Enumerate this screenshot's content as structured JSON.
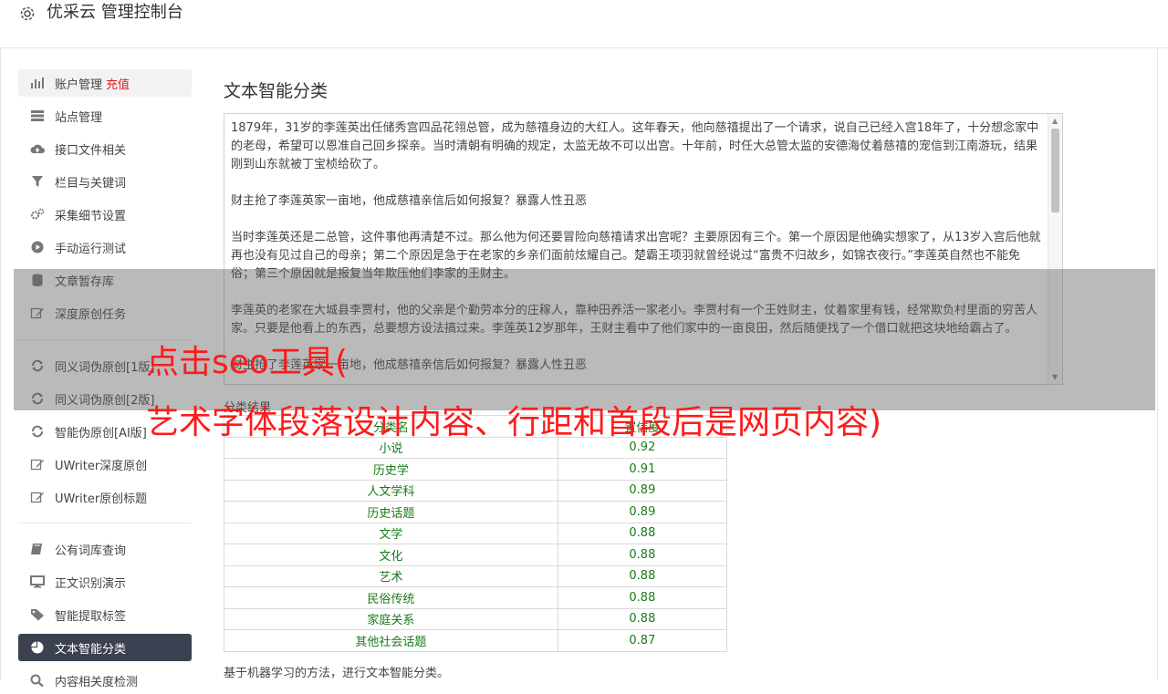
{
  "header": {
    "title": "优采云 管理控制台"
  },
  "sidebar": {
    "items": [
      {
        "label": "账户管理",
        "badge": "充值",
        "icon": "bar-chart-icon"
      },
      {
        "label": "站点管理",
        "icon": "server-icon"
      },
      {
        "label": "接口文件相关",
        "icon": "cloud-upload-icon"
      },
      {
        "label": "栏目与关键词",
        "icon": "filter-icon"
      },
      {
        "label": "采集细节设置",
        "icon": "gears-icon"
      },
      {
        "label": "手动运行测试",
        "icon": "play-circle-icon"
      },
      {
        "label": "文章暂存库",
        "icon": "database-icon"
      },
      {
        "label": "深度原创任务",
        "icon": "edit-icon"
      },
      {
        "label": "同义词伪原创[1版]",
        "icon": "refresh-icon"
      },
      {
        "label": "同义词伪原创[2版]",
        "icon": "refresh-icon"
      },
      {
        "label": "智能伪原创[AI版]",
        "icon": "refresh-icon"
      },
      {
        "label": "UWriter深度原创",
        "icon": "edit-icon"
      },
      {
        "label": "UWriter原创标题",
        "icon": "edit-icon"
      },
      {
        "label": "公有词库查询",
        "icon": "book-icon"
      },
      {
        "label": "正文识别演示",
        "icon": "monitor-icon"
      },
      {
        "label": "智能提取标签",
        "icon": "tag-icon"
      },
      {
        "label": "文本智能分类",
        "icon": "pie-chart-icon"
      },
      {
        "label": "内容相关度检测",
        "icon": "search-icon"
      }
    ]
  },
  "main": {
    "title": "文本智能分类",
    "paragraphs": [
      "1879年，31岁的李莲英出任储秀宫四品花翎总管，成为慈禧身边的大红人。这年春天，他向慈禧提出了一个请求，说自己已经入宫18年了，十分想念家中的老母，希望可以恩准自己回乡探亲。当时清朝有明确的规定，太监无故不可以出宫。十年前，时任大总管太监的安德海仗着慈禧的宠信到江南游玩，结果刚到山东就被丁宝桢给砍了。",
      "财主抢了李莲英家一亩地，他成慈禧亲信后如何报复？暴露人性丑恶",
      "当时李莲英还是二总管，这件事他再清楚不过。那么他为何还要冒险向慈禧请求出宫呢？主要原因有三个。第一个原因是他确实想家了，从13岁入宫后他就再也没有见过自己的母亲；第二个原因是急于在老家的乡亲们面前炫耀自己。楚霸王项羽就曾经说过“富贵不归故乡，如锦衣夜行。”李莲英自然也不能免俗；第三个原因就是报复当年欺压他们李家的王财主。",
      "李莲英的老家在大城县李贾村，他的父亲是个勤劳本分的庄稼人，靠种田养活一家老小。李贾村有一个王姓财主，仗着家里有钱，经常欺负村里面的穷苦人家。只要是他看上的东西，总要想方设法搞过来。李莲英12岁那年，王财主看中了他们家中的一亩良田，然后随便找了一个借口就把这块地给霸占了。",
      "财主抢了李莲英家一亩地，他成慈禧亲信后如何报复？暴露人性丑恶"
    ],
    "result_label": "分类结果",
    "table": {
      "headers": [
        "分类名",
        "置信度"
      ],
      "rows": [
        [
          "小说",
          "0.92"
        ],
        [
          "历史学",
          "0.91"
        ],
        [
          "人文学科",
          "0.89"
        ],
        [
          "历史话题",
          "0.89"
        ],
        [
          "文学",
          "0.88"
        ],
        [
          "文化",
          "0.88"
        ],
        [
          "艺术",
          "0.88"
        ],
        [
          "民俗传统",
          "0.88"
        ],
        [
          "家庭关系",
          "0.88"
        ],
        [
          "其他社会话题",
          "0.87"
        ]
      ]
    },
    "footnote": "基于机器学习的方法，进行文本智能分类。"
  },
  "overlay": {
    "line1": "点击seo工具(",
    "line2": "艺术字体段落设计内容、行距和首段后是网页内容)"
  }
}
